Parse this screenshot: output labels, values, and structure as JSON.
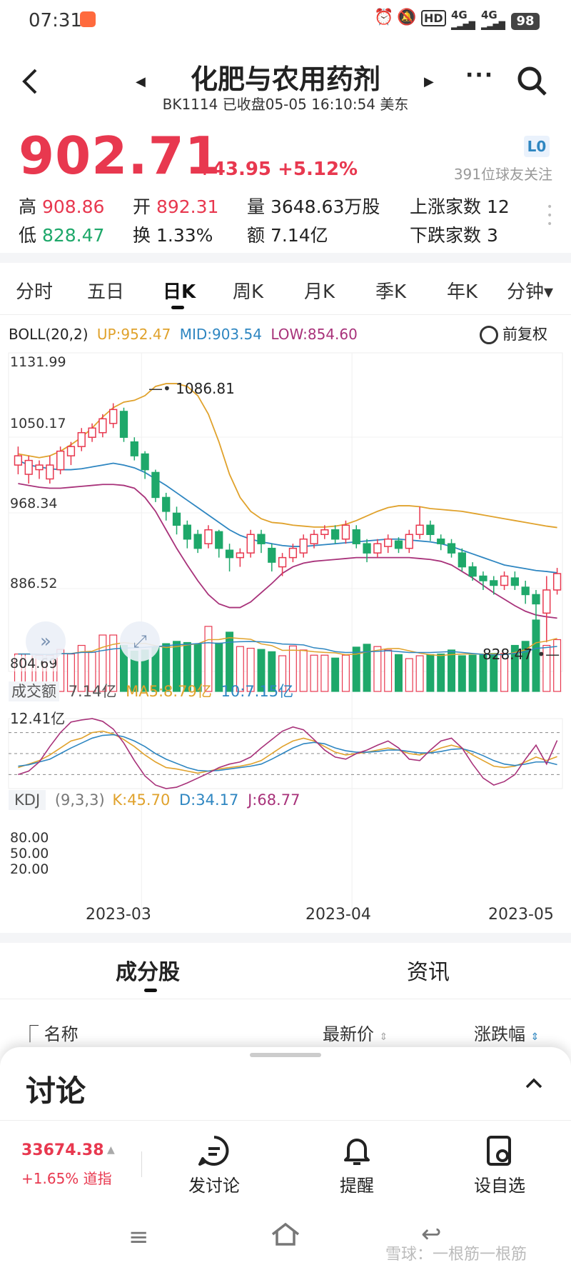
{
  "status": {
    "time": "07:31",
    "signal1": "4G",
    "signal2": "4G",
    "hd": "HD",
    "battery": "98"
  },
  "header": {
    "title": "化肥与农用药剂",
    "subtitle": "BK1114 已收盘05-05 16:10:54 美东"
  },
  "quote": {
    "price": "902.71",
    "change": "+43.95",
    "change_pct": "+5.12%",
    "level_badge": "L0",
    "followers": "391位球友关注",
    "high_label": "高",
    "high": "908.86",
    "open_label": "开",
    "open": "892.31",
    "vol_label": "量",
    "vol": "3648.63万股",
    "up_label": "上涨家数",
    "up_count": "12",
    "low_label": "低",
    "low": "828.47",
    "turnover_label": "换",
    "turnover": "1.33%",
    "amount_label": "额",
    "amount": "7.14亿",
    "down_label": "下跌家数",
    "down_count": "3"
  },
  "tabs": [
    "分时",
    "五日",
    "日K",
    "周K",
    "月K",
    "季K",
    "年K",
    "分钟▾"
  ],
  "boll": {
    "name": "BOLL(20,2)",
    "up": "UP:952.47",
    "mid": "MID:903.54",
    "low": "LOW:854.60",
    "adjust": "前复权"
  },
  "yaxis": [
    "1131.99",
    "1050.17",
    "968.34",
    "886.52",
    "804.69"
  ],
  "annotations": {
    "high": "1086.81",
    "low": "828.47"
  },
  "volume": {
    "label": "成交额",
    "value": "7.14亿",
    "ma5": "MA5:8.79亿",
    "ma10": "10:7.15亿",
    "max": "12.41亿"
  },
  "kdj": {
    "label": "KDJ",
    "params": "(9,3,3)",
    "k": "K:45.70",
    "d": "D:34.17",
    "j": "J:68.77",
    "levels": [
      "80.00",
      "50.00",
      "20.00"
    ]
  },
  "xaxis": [
    "2023-03",
    "2023-04",
    "2023-05"
  ],
  "section_tabs": [
    "成分股",
    "资讯"
  ],
  "list_header": {
    "name": "名称",
    "price": "最新价",
    "change": "涨跌幅"
  },
  "sheet": {
    "title": "讨论",
    "index_value": "33674.38",
    "index_change": "+1.65% 道指",
    "btn_post": "发讨论",
    "btn_alert": "提醒",
    "btn_watch": "设自选"
  },
  "watermark": "雪球：一根筋一根筋",
  "colors": {
    "up": "#e8384f",
    "down": "#1ea86a",
    "boll_up": "#e0a22c",
    "boll_mid": "#2e86c1",
    "boll_low": "#a8327a"
  },
  "chart_data": {
    "type": "candlestick",
    "ylim": [
      804.69,
      1131.99
    ],
    "candles": [
      [
        1020,
        1030,
        1040,
        1010
      ],
      [
        1010,
        1025,
        1030,
        1000
      ],
      [
        1015,
        1020,
        1025,
        1005
      ],
      [
        1005,
        1020,
        1030,
        1000
      ],
      [
        1015,
        1035,
        1040,
        1010
      ],
      [
        1030,
        1040,
        1045,
        1020
      ],
      [
        1040,
        1055,
        1060,
        1035
      ],
      [
        1050,
        1060,
        1065,
        1045
      ],
      [
        1055,
        1070,
        1075,
        1050
      ],
      [
        1065,
        1080,
        1086.81,
        1060
      ],
      [
        1078,
        1050,
        1082,
        1045
      ],
      [
        1045,
        1030,
        1050,
        1025
      ],
      [
        1032,
        1015,
        1035,
        1005
      ],
      [
        1012,
        985,
        1015,
        980
      ],
      [
        985,
        970,
        990,
        960
      ],
      [
        968,
        955,
        975,
        945
      ],
      [
        955,
        940,
        960,
        930
      ],
      [
        945,
        930,
        950,
        925
      ],
      [
        935,
        950,
        955,
        930
      ],
      [
        948,
        930,
        950,
        920
      ],
      [
        928,
        920,
        935,
        905
      ],
      [
        920,
        925,
        930,
        910
      ],
      [
        925,
        945,
        950,
        920
      ],
      [
        945,
        935,
        950,
        925
      ],
      [
        930,
        915,
        935,
        905
      ],
      [
        910,
        920,
        925,
        900
      ],
      [
        920,
        930,
        935,
        915
      ],
      [
        925,
        940,
        945,
        920
      ],
      [
        935,
        945,
        950,
        930
      ],
      [
        945,
        950,
        955,
        940
      ],
      [
        950,
        940,
        955,
        935
      ],
      [
        940,
        955,
        960,
        935
      ],
      [
        950,
        935,
        955,
        930
      ],
      [
        935,
        925,
        940,
        915
      ],
      [
        925,
        935,
        940,
        920
      ],
      [
        932,
        940,
        945,
        925
      ],
      [
        938,
        930,
        942,
        925
      ],
      [
        930,
        945,
        950,
        925
      ],
      [
        945,
        955,
        975,
        940
      ],
      [
        955,
        945,
        960,
        938
      ],
      [
        940,
        935,
        945,
        928
      ],
      [
        935,
        925,
        940,
        920
      ],
      [
        925,
        910,
        930,
        905
      ],
      [
        910,
        900,
        915,
        895
      ],
      [
        900,
        895,
        905,
        885
      ],
      [
        895,
        890,
        900,
        880
      ],
      [
        890,
        900,
        905,
        885
      ],
      [
        898,
        890,
        905,
        885
      ],
      [
        888,
        880,
        895,
        870
      ],
      [
        880,
        870,
        885,
        850
      ],
      [
        860,
        885,
        900,
        828.47
      ],
      [
        885,
        902.71,
        908.86,
        880
      ]
    ],
    "boll_up": [
      1032,
      1030,
      1028,
      1030,
      1035,
      1042,
      1050,
      1060,
      1072,
      1082,
      1088,
      1090,
      1095,
      1105,
      1108,
      1108,
      1105,
      1095,
      1075,
      1045,
      1010,
      985,
      970,
      962,
      958,
      957,
      955,
      954,
      953,
      953,
      954,
      956,
      960,
      965,
      970,
      974,
      976,
      976,
      975,
      973,
      972,
      971,
      970,
      968,
      966,
      964,
      962,
      960,
      958,
      956,
      954,
      952.47
    ],
    "boll_mid": [
      1025,
      1020,
      1018,
      1016,
      1015,
      1015,
      1016,
      1018,
      1020,
      1022,
      1020,
      1017,
      1012,
      1005,
      998,
      990,
      982,
      974,
      966,
      958,
      950,
      944,
      940,
      937,
      935,
      933,
      932,
      932,
      933,
      934,
      935,
      936,
      937,
      938,
      939,
      940,
      940,
      939,
      938,
      937,
      935,
      932,
      928,
      924,
      920,
      916,
      912,
      910,
      908,
      906,
      905,
      903.54
    ],
    "boll_low": [
      1000,
      998,
      996,
      995,
      995,
      996,
      997,
      998,
      999,
      999,
      998,
      995,
      985,
      970,
      950,
      930,
      912,
      895,
      880,
      870,
      866,
      866,
      872,
      882,
      892,
      903,
      910,
      914,
      916,
      917,
      918,
      919,
      920,
      920,
      920,
      920,
      920,
      920,
      919,
      918,
      916,
      912,
      905,
      898,
      890,
      882,
      875,
      868,
      862,
      858,
      856,
      854.6
    ],
    "volume_amount": [
      6.5,
      6.5,
      6.3,
      6.3,
      7.3,
      6.5,
      8,
      6.8,
      9.8,
      9.8,
      8,
      7,
      7.2,
      7.7,
      8.3,
      8.7,
      8.5,
      8.2,
      11.3,
      8.4,
      10.3,
      7.8,
      7.5,
      7.3,
      6.9,
      6.2,
      7.9,
      7.2,
      6.3,
      6.3,
      5.8,
      6.3,
      7.7,
      8.2,
      7.8,
      7.2,
      6.4,
      5.7,
      6.2,
      6.4,
      6.5,
      7.2,
      6.2,
      6.3,
      6.3,
      6.6,
      6.6,
      8,
      8.7,
      12.41,
      8,
      9
    ],
    "kdj_k": [
      30,
      35,
      40,
      48,
      58,
      68,
      72,
      80,
      82,
      78,
      70,
      60,
      48,
      38,
      30,
      28,
      25,
      22,
      25,
      28,
      30,
      32,
      35,
      40,
      50,
      60,
      68,
      72,
      68,
      60,
      52,
      48,
      50,
      52,
      55,
      58,
      55,
      50,
      48,
      52,
      58,
      62,
      58,
      48,
      40,
      32,
      30,
      32,
      38,
      45,
      40,
      45.7
    ],
    "kdj_d": [
      32,
      34,
      38,
      42,
      50,
      58,
      65,
      72,
      76,
      77,
      74,
      68,
      60,
      50,
      42,
      36,
      30,
      26,
      25,
      26,
      28,
      30,
      32,
      35,
      42,
      50,
      58,
      64,
      66,
      64,
      58,
      54,
      52,
      52,
      53,
      55,
      55,
      53,
      51,
      51,
      53,
      56,
      57,
      53,
      47,
      40,
      35,
      33,
      35,
      38,
      38,
      34.17
    ],
    "kdj_j": [
      20,
      25,
      38,
      60,
      80,
      95,
      98,
      100,
      96,
      85,
      65,
      40,
      18,
      5,
      0,
      2,
      8,
      15,
      22,
      30,
      35,
      38,
      45,
      58,
      70,
      82,
      88,
      84,
      70,
      55,
      45,
      42,
      50,
      55,
      62,
      68,
      58,
      42,
      40,
      55,
      68,
      72,
      58,
      35,
      15,
      5,
      10,
      20,
      42,
      62,
      35,
      68.77
    ]
  }
}
